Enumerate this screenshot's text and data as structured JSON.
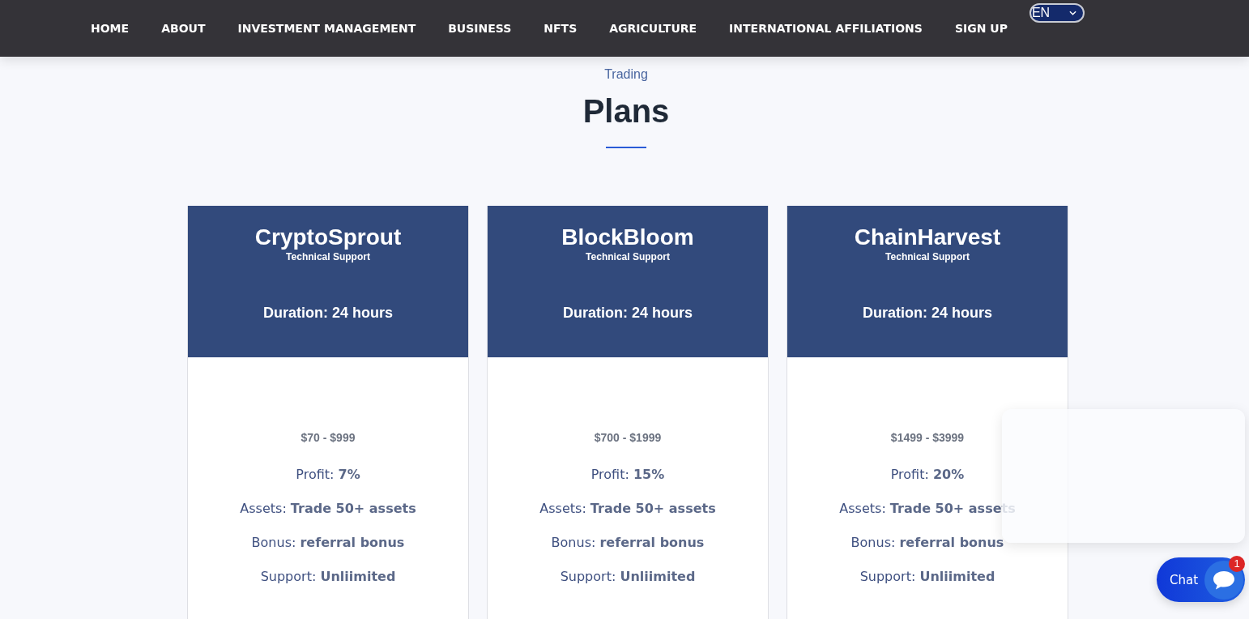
{
  "nav": {
    "items": [
      {
        "label": "HOME"
      },
      {
        "label": "ABOUT"
      },
      {
        "label": "INVESTMENT MANAGEMENT"
      },
      {
        "label": "BUSINESS"
      },
      {
        "label": "NFTS"
      },
      {
        "label": "AGRICULTURE"
      },
      {
        "label": "INTERNATIONAL AFFILIATIONS"
      },
      {
        "label": "SIGN UP"
      }
    ],
    "language": {
      "value": "EN"
    }
  },
  "section": {
    "eyebrow": "Trading",
    "title": "Plans"
  },
  "plans": [
    {
      "name": "CryptoSprout",
      "subtitle": "Technical Support",
      "duration": "Duration: 24 hours",
      "price": "$70 - $999",
      "features": [
        "Profit: **7%**",
        "Assets: **Trade 50+ assets**",
        "Bonus: **referral bonus**",
        "Support: **Unliimited**"
      ]
    },
    {
      "name": "BlockBloom",
      "subtitle": "Technical Support",
      "duration": "Duration: 24 hours",
      "price": "$700 - $1999",
      "features": [
        "Profit: **15%**",
        "Assets: **Trade 50+ assets**",
        "Bonus: **referral bonus**",
        "Support: **Unliimited**"
      ]
    },
    {
      "name": "ChainHarvest",
      "subtitle": "Technical Support",
      "duration": "Duration: 24 hours",
      "price": "$1499 - $3999",
      "features": [
        "Profit: **20%**",
        "Assets: **Trade 50+ assets**",
        "Bonus: **referral bonus**",
        "Support: **Unliimited**"
      ]
    }
  ],
  "chat": {
    "label": "Chat",
    "badge": "1"
  }
}
